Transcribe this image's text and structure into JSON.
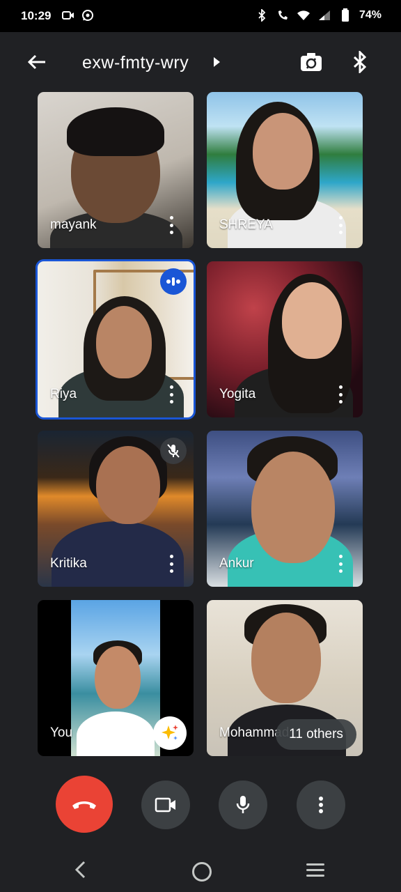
{
  "status_bar": {
    "time": "10:29",
    "battery": "74%",
    "left_icons": [
      "video-call-notification-icon",
      "whatsapp-icon"
    ],
    "right_icons": [
      "bluetooth-icon",
      "wifi-calling-icon",
      "wifi-icon",
      "signal-icon",
      "battery-icon"
    ]
  },
  "header": {
    "meeting_code": "exw-fmty-wry",
    "back_icon": "arrow-left-icon",
    "flip_icon": "switch-camera-icon",
    "audio_icon": "bluetooth-icon"
  },
  "participants": [
    {
      "name": "mayank"
    },
    {
      "name": "SHREYA"
    },
    {
      "name": "Riya",
      "speaking": true
    },
    {
      "name": "Yogita"
    },
    {
      "name": "Kritika",
      "muted": true
    },
    {
      "name": "Ankur"
    },
    {
      "name": "You"
    },
    {
      "name": "Mohammad"
    }
  ],
  "others_label": "11 others",
  "controls": {
    "end_call": "call-end-icon",
    "camera": "videocam-icon",
    "mic": "mic-icon",
    "more": "more-vert-icon"
  },
  "colors": {
    "background": "#202124",
    "end_call": "#ea4335",
    "active_speaker": "#1a56d6",
    "control_bg": "#3c4043"
  }
}
